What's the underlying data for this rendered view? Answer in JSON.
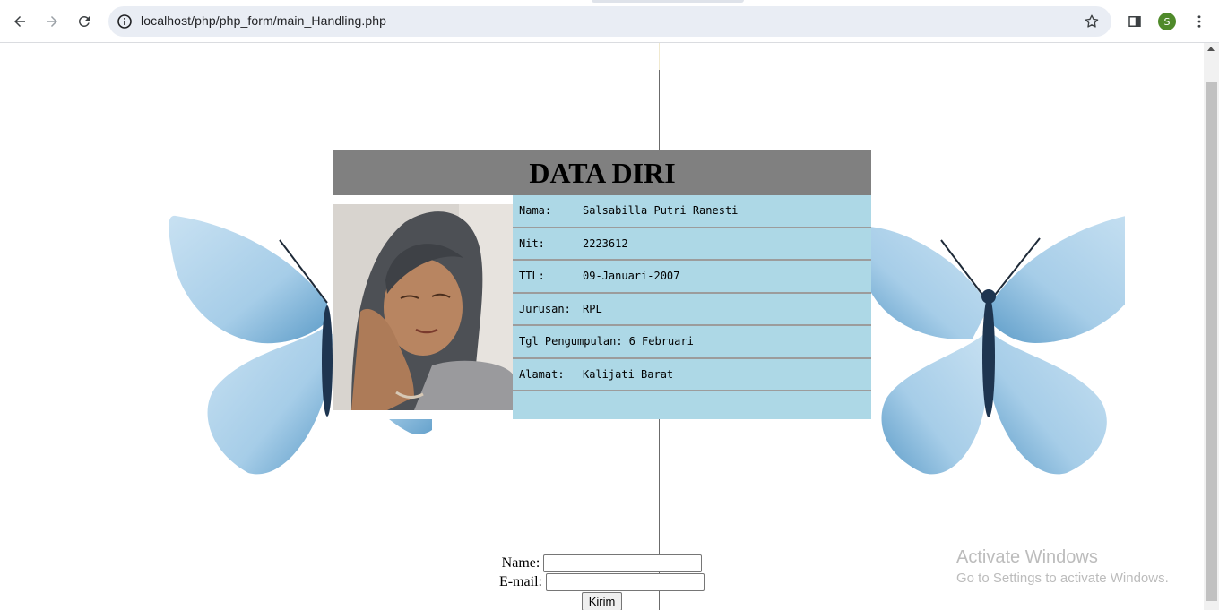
{
  "browser": {
    "url": "localhost/php/php_form/main_Handling.php",
    "profile_initial": "S",
    "icons": {
      "back": "arrow-left-icon",
      "forward": "arrow-right-icon",
      "reload": "reload-icon",
      "site_info": "info-icon",
      "bookmark": "star-icon",
      "side_panel": "side-panel-icon",
      "menu": "kebab-menu-icon"
    }
  },
  "card": {
    "title": "DATA DIRI",
    "header_color": "#808080",
    "panel_color": "#add8e6",
    "rows": [
      {
        "label": "Nama:",
        "value": "Salsabilla Putri Ranesti"
      },
      {
        "label": "Nit:",
        "value": "2223612"
      },
      {
        "label": "TTL:",
        "value": "09-Januari-2007"
      },
      {
        "label": "Jurusan:",
        "value": "RPL"
      },
      {
        "label": "Tgl Pengumpulan:",
        "value": "6 Februari"
      },
      {
        "label": "Alamat:",
        "value": "Kalijati Barat"
      }
    ]
  },
  "form": {
    "name_label": "Name:",
    "email_label": "E-mail:",
    "name_value": "",
    "email_value": "",
    "submit_label": "Kirim"
  },
  "watermark": {
    "title": "Activate Windows",
    "subtitle": "Go to Settings to activate Windows."
  },
  "decor": {
    "butterfly_color": "#a9cfe6"
  }
}
